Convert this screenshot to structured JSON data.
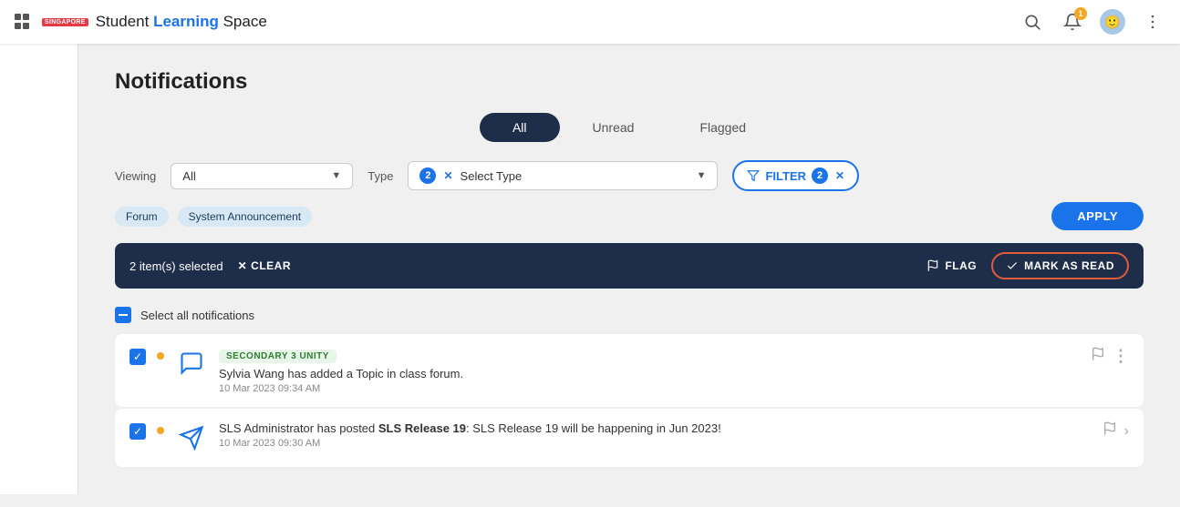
{
  "header": {
    "singapore_label": "SINGAPORE",
    "logo_text_student": "Student",
    "logo_text_learning": "Learning",
    "logo_text_space": "Space",
    "notif_count": "1",
    "search_icon": "search-icon",
    "bell_icon": "bell-icon",
    "avatar_icon": "avatar-icon",
    "more_icon": "more-icon"
  },
  "page": {
    "title": "Notifications",
    "tabs": [
      {
        "label": "All",
        "active": true
      },
      {
        "label": "Unread",
        "active": false
      },
      {
        "label": "Flagged",
        "active": false
      }
    ]
  },
  "filters": {
    "viewing_label": "Viewing",
    "viewing_value": "All",
    "type_label": "Type",
    "type_placeholder": "Select Type",
    "type_count": "2",
    "filter_label": "FILTER",
    "filter_count": "2",
    "tags": [
      {
        "label": "Forum"
      },
      {
        "label": "System Announcement"
      }
    ],
    "apply_label": "APPLY"
  },
  "selection_bar": {
    "count_text": "2 item(s) selected",
    "clear_label": "CLEAR",
    "flag_label": "FLAG",
    "mark_read_label": "MARK AS READ"
  },
  "select_all": {
    "label": "Select all notifications"
  },
  "notifications": [
    {
      "id": "notif-1",
      "checked": true,
      "unread": true,
      "tag": "SECONDARY 3 UNITY",
      "icon_type": "forum",
      "text": "Sylvia Wang has added a Topic in class forum.",
      "time": "10 Mar 2023 09:34 AM",
      "has_more": true,
      "has_arrow": false
    },
    {
      "id": "notif-2",
      "checked": true,
      "unread": true,
      "tag": null,
      "icon_type": "announcement",
      "text_plain": "SLS Administrator has posted ",
      "text_bold": "SLS Release 19",
      "text_after": ": SLS Release 19 will be happening in Jun 2023!",
      "time": "10 Mar 2023 09:30 AM",
      "has_more": false,
      "has_arrow": true
    }
  ]
}
